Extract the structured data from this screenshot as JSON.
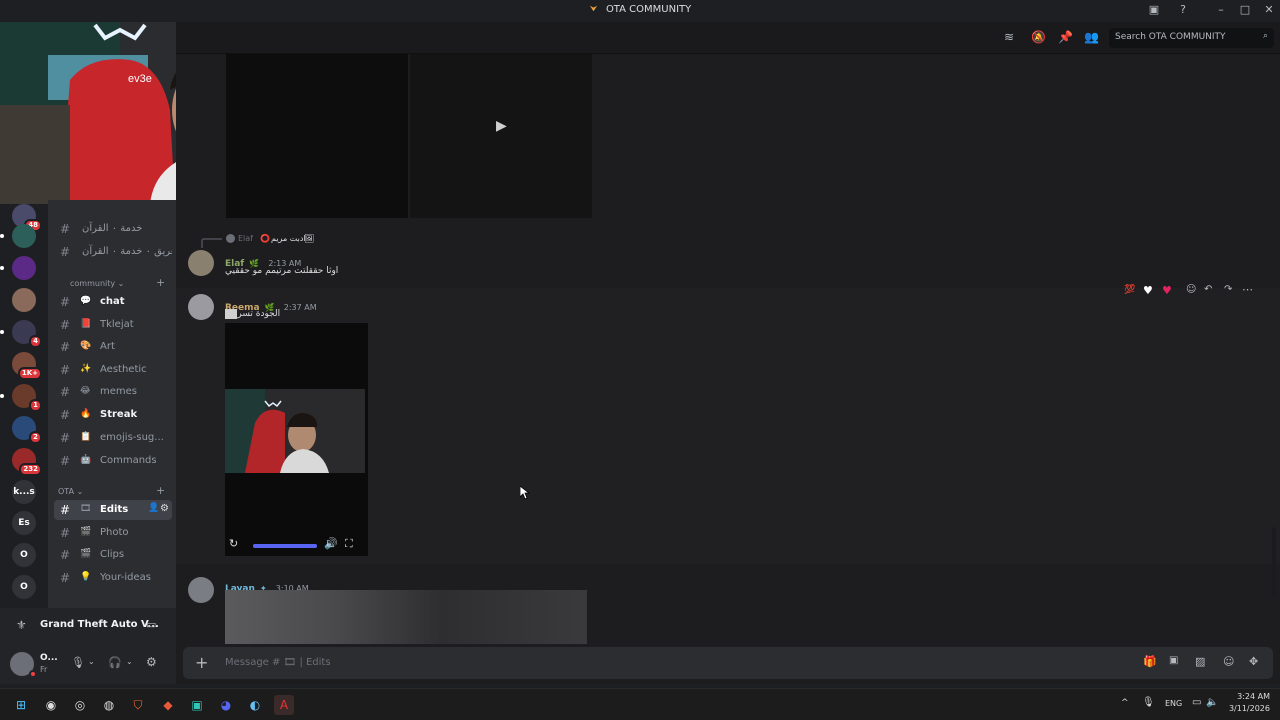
{
  "window": {
    "title": "OTA COMMUNITY"
  },
  "topbar": {
    "search_placeholder": "Search OTA COMMUNITY"
  },
  "servers": [
    {
      "badge": "48",
      "color": "#4a4a6a"
    },
    {
      "badge": "",
      "color": "#2c5f5a"
    },
    {
      "badge": "",
      "color": "#5b2a86"
    },
    {
      "badge": "",
      "color": "#8a6a5a"
    },
    {
      "badge": "4",
      "color": "#3a3a52"
    },
    {
      "badge": "1K+",
      "color": "#7a4a3a"
    },
    {
      "badge": "1",
      "color": "#6a3a2a"
    },
    {
      "badge": "2",
      "color": "#2a4a7a"
    },
    {
      "badge": "232",
      "color": "#9a2a2a"
    },
    {
      "text": "k...s",
      "badge": ""
    },
    {
      "text": "Es",
      "badge": ""
    },
    {
      "text": "O",
      "badge": ""
    },
    {
      "text": "O",
      "badge": ""
    }
  ],
  "channels_top": [
    {
      "label": "خدمة ٠ القرآن",
      "emo": "👫"
    },
    {
      "label": "تغريق ٠ خدمة ٠ القرآن",
      "emo": ""
    }
  ],
  "category_community": "community",
  "community_channels": [
    {
      "label": "chat",
      "emo": "💬",
      "bold": true
    },
    {
      "label": "Tklejat",
      "emo": "📕",
      "bold": false
    },
    {
      "label": "Art",
      "emo": "🎨",
      "bold": false
    },
    {
      "label": "Aesthetic",
      "emo": "✨",
      "bold": false
    },
    {
      "label": "memes",
      "emo": "😂",
      "bold": false
    },
    {
      "label": "Streak",
      "emo": "🔥",
      "bold": true
    },
    {
      "label": "emojis-sug...",
      "emo": "📋",
      "bold": false
    },
    {
      "label": "Commands",
      "emo": "🤖",
      "bold": false
    }
  ],
  "category_ota": "OTA",
  "ota_channels": [
    {
      "label": "Edits",
      "emo": "🎞",
      "active": true
    },
    {
      "label": "Photo",
      "emo": "🎬"
    },
    {
      "label": "Clips",
      "emo": "🎬"
    },
    {
      "label": "Your-ideas",
      "emo": "💡"
    }
  ],
  "activity": {
    "game": "Grand Theft Auto V..."
  },
  "user": {
    "name": "O...",
    "status": "Fr"
  },
  "messages": [
    {
      "reply_to": "Elaf",
      "reply_text": "ادبت مريم",
      "author": "Elaf",
      "author_color": "#8fa86a",
      "time": "2:13 AM",
      "text": "اوثا حققلتت مرتيمم مو حققيي"
    },
    {
      "author": "Reema",
      "author_color": "#c9a66b",
      "time": "2:37 AM",
      "text": "الجودة تسرع"
    },
    {
      "author": "Layan",
      "author_color": "#6fb8d9",
      "time": "3:10 AM",
      "text": ""
    }
  ],
  "composer": {
    "placeholder": "Message # 🎞 | Edits"
  },
  "taskbar": {
    "lang": "ENG",
    "time": "3:24 AM",
    "date": "3/11/2026"
  },
  "colors": {
    "accent": "#5865f2",
    "bg": "#1d1d1f",
    "sidebar": "#2b2d31",
    "rail": "#1e1f22"
  }
}
